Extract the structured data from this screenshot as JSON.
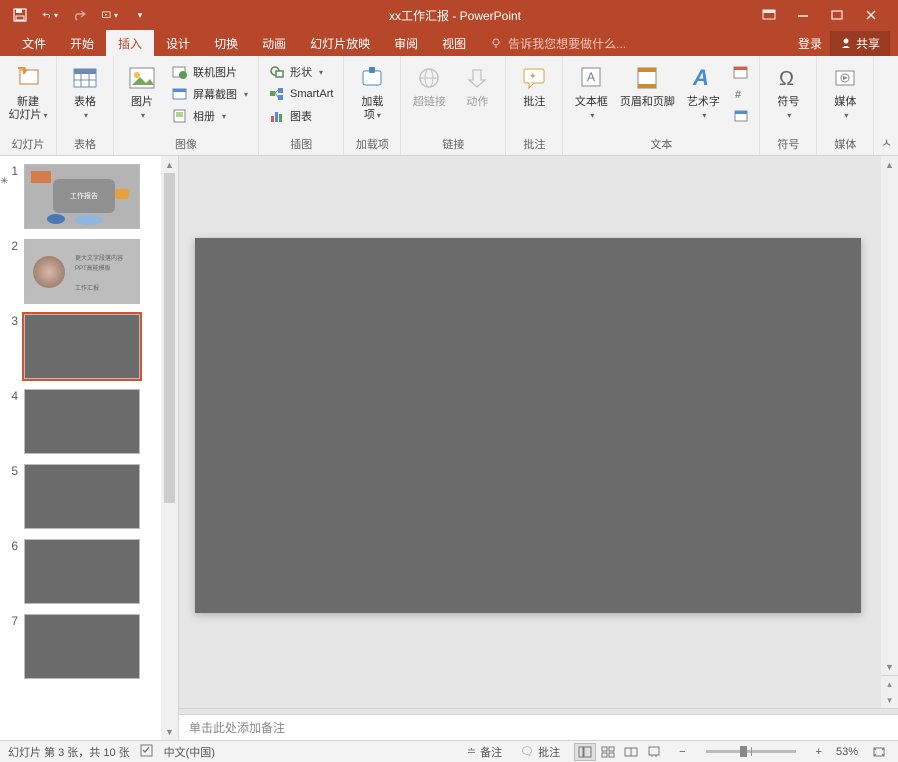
{
  "title": "xx工作汇报 - PowerPoint",
  "menubar": {
    "tabs": [
      "文件",
      "开始",
      "插入",
      "设计",
      "切换",
      "动画",
      "幻灯片放映",
      "审阅",
      "视图"
    ],
    "active_index": 2,
    "tell_me": "告诉我您想要做什么...",
    "login": "登录",
    "share": "共享"
  },
  "ribbon": {
    "groups": {
      "slides": {
        "label": "幻灯片",
        "new_slide": "新建\n幻灯片"
      },
      "tables": {
        "label": "表格",
        "table": "表格"
      },
      "images": {
        "label": "图像",
        "picture": "图片",
        "online": "联机图片",
        "screenshot": "屏幕截图",
        "album": "相册"
      },
      "illustrations": {
        "label": "插图",
        "shapes": "形状",
        "smartart": "SmartArt",
        "chart": "图表"
      },
      "addins": {
        "label": "加载项",
        "btn": "加载\n项"
      },
      "links": {
        "label": "链接",
        "hyperlink": "超链接",
        "action": "动作"
      },
      "comments": {
        "label": "批注",
        "comment": "批注"
      },
      "text": {
        "label": "文本",
        "textbox": "文本框",
        "header_footer": "页眉和页脚",
        "wordart": "艺术字"
      },
      "symbols": {
        "label": "符号",
        "symbol": "符号"
      },
      "media": {
        "label": "媒体",
        "media": "媒体"
      }
    }
  },
  "thumbs": {
    "selected": 3,
    "count": 7,
    "slide1_title": "工作报告"
  },
  "notes_placeholder": "单击此处添加备注",
  "statusbar": {
    "slide_info": "幻灯片 第 3 张，共 10 张",
    "language": "中文(中国)",
    "notes": "备注",
    "comments": "批注",
    "zoom": "53%"
  }
}
